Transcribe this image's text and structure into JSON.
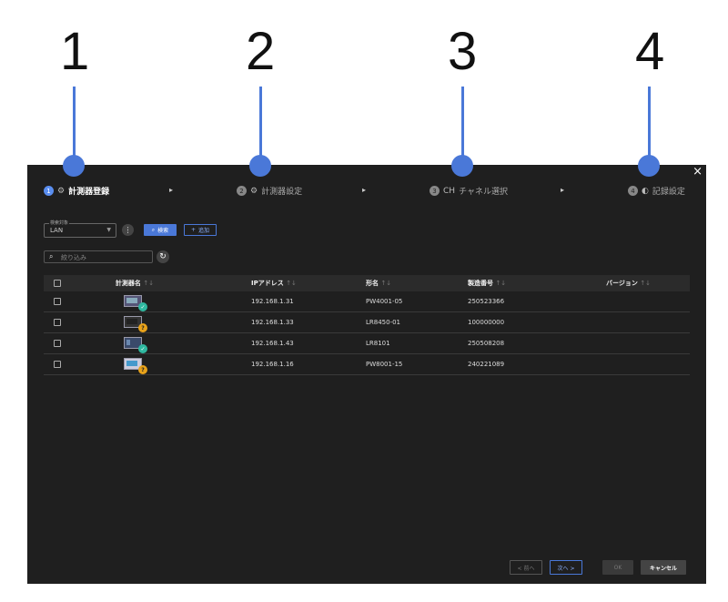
{
  "callouts": [
    "1",
    "2",
    "3",
    "4"
  ],
  "dialog": {
    "close": "×",
    "steps": [
      {
        "num": "1",
        "icon": "⚙",
        "label": "計測器登録",
        "active": true
      },
      {
        "num": "2",
        "icon": "⚙",
        "label": "計測器設定",
        "active": false
      },
      {
        "num": "3",
        "icon": "CH",
        "label": "チャネル選択",
        "active": false
      },
      {
        "num": "4",
        "icon": "◐",
        "label": "記録設定",
        "active": false
      }
    ],
    "step_arrow": "▸",
    "search": {
      "target_label": "検索対象",
      "target_value": "LAN",
      "search_button": "検索",
      "add_button": "追加"
    },
    "filter_placeholder": "絞り込み",
    "table": {
      "headers": [
        "計測器名",
        "IPアドレス",
        "形名",
        "製造番号",
        "バージョン"
      ],
      "sort_icon": "↑↓",
      "rows": [
        {
          "ip": "192.168.1.31",
          "model": "PW4001-05",
          "serial": "250523366",
          "version": "",
          "status": "ok"
        },
        {
          "ip": "192.168.1.33",
          "model": "LR8450-01",
          "serial": "100000000",
          "version": "",
          "status": "warn"
        },
        {
          "ip": "192.168.1.43",
          "model": "LR8101",
          "serial": "250508208",
          "version": "",
          "status": "ok"
        },
        {
          "ip": "192.168.1.16",
          "model": "PW8001-15",
          "serial": "240221089",
          "version": "",
          "status": "warn"
        }
      ]
    },
    "footer": {
      "prev": "< 前へ",
      "next": "次へ >",
      "ok": "OK",
      "cancel": "キャンセル"
    }
  }
}
